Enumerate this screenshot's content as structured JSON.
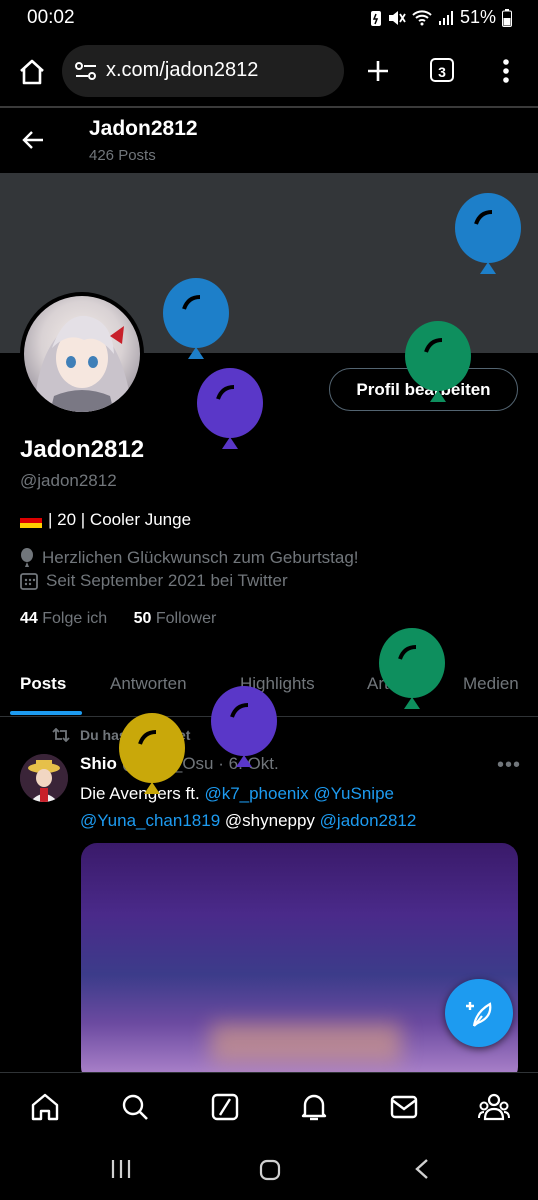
{
  "status_bar": {
    "time": "00:02",
    "battery": "51%"
  },
  "browser": {
    "url": "x.com/jadon2812",
    "tab_count": "3"
  },
  "header": {
    "title": "Jadon2812",
    "post_count": "426 Posts"
  },
  "profile": {
    "display_name": "Jadon2812",
    "handle": "@jadon2812",
    "bio": "| 20 | Cooler Junge",
    "birthday_text": "Herzlichen Glückwunsch zum Geburtstag!",
    "joined_text": "Seit September 2021 bei Twitter",
    "following_count": "44",
    "following_label": "Folge ich",
    "followers_count": "50",
    "followers_label": "Follower",
    "edit_button": "Profil bearbeiten"
  },
  "tabs": [
    {
      "label": "Posts",
      "active": true
    },
    {
      "label": "Antworten",
      "active": false
    },
    {
      "label": "Highlights",
      "active": false
    },
    {
      "label": "Artikel",
      "active": false
    },
    {
      "label": "Medien",
      "active": false
    }
  ],
  "post": {
    "repost_label": "Du hast repostet",
    "author_name": "Shio",
    "author_handle": "@Shio_Osu",
    "date": "6. Okt.",
    "text_start": "Die Avengers ft.",
    "mentions": [
      "@k7_phoenix",
      "@YuSnipe",
      "@Yuna_chan1819",
      "@jadon2812"
    ],
    "plain_mention": "@shyneppy"
  },
  "bottom_nav": [
    "home-icon",
    "search-icon",
    "grok-icon",
    "notifications-icon",
    "messages-icon",
    "communities-icon"
  ],
  "colors": {
    "accent": "#1d9bf0",
    "balloon_blue": "#1d7fc9",
    "balloon_green": "#0e8f5e",
    "balloon_purple": "#5a37c8",
    "balloon_yellow": "#c9a80a"
  }
}
